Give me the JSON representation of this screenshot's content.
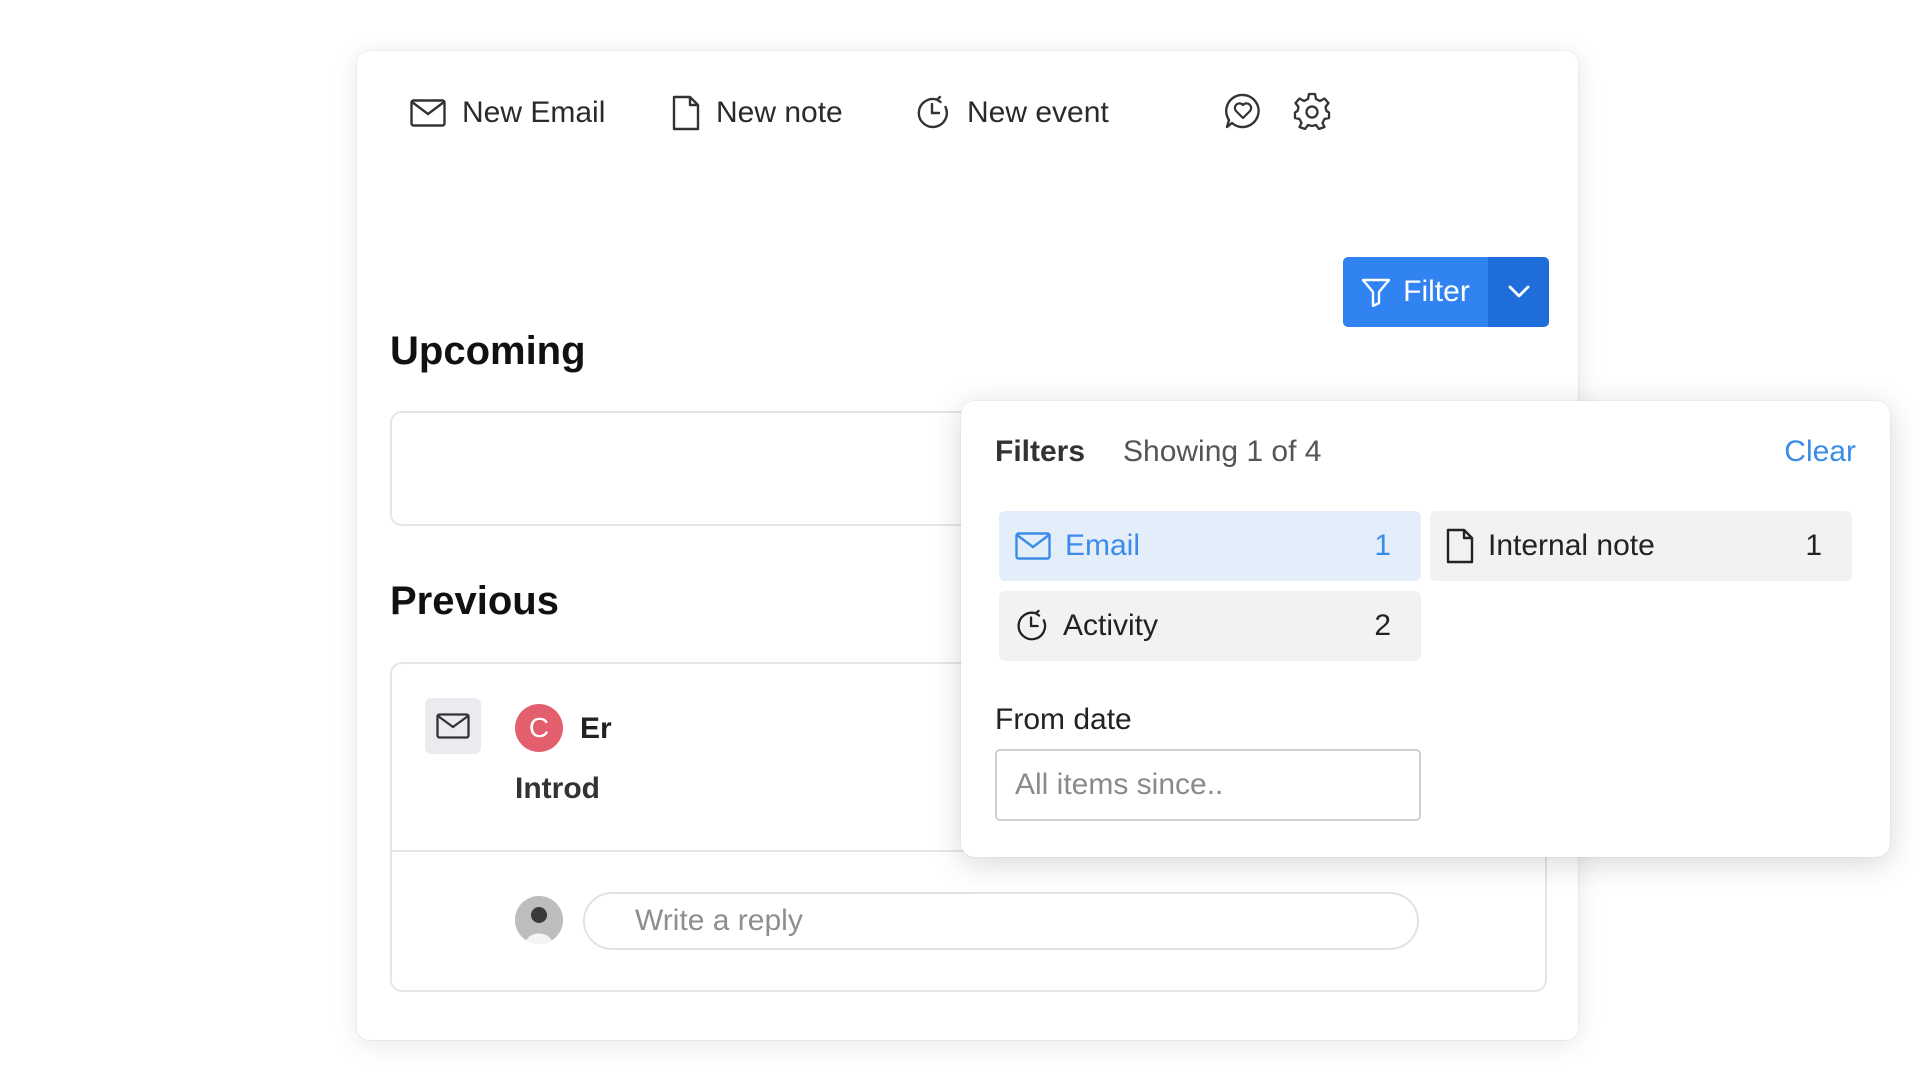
{
  "toolbar": {
    "new_email_label": "New Email",
    "new_note_label": "New note",
    "new_event_label": "New event",
    "chat_icon": "heart-chat-icon",
    "settings_icon": "gear-icon"
  },
  "filter_button": {
    "label": "Filter",
    "color": "#3083f0",
    "caret_color": "#1e6ddb"
  },
  "sections": {
    "upcoming_title": "Upcoming",
    "previous_title": "Previous"
  },
  "email_item": {
    "avatar_letter": "C",
    "avatar_color": "#e45f6e",
    "sender_partial": "Er",
    "subject_partial": "Introd"
  },
  "reply": {
    "placeholder": "Write a reply"
  },
  "filters_popover": {
    "title": "Filters",
    "showing": "Showing 1 of 4",
    "clear_label": "Clear",
    "options": [
      {
        "label": "Email",
        "count": "1",
        "icon": "envelope-icon",
        "active": true
      },
      {
        "label": "Internal note",
        "count": "1",
        "icon": "document-icon",
        "active": false
      },
      {
        "label": "Activity",
        "count": "2",
        "icon": "clock-icon",
        "active": false
      }
    ],
    "from_date_label": "From date",
    "from_date_placeholder": "All items since.."
  }
}
